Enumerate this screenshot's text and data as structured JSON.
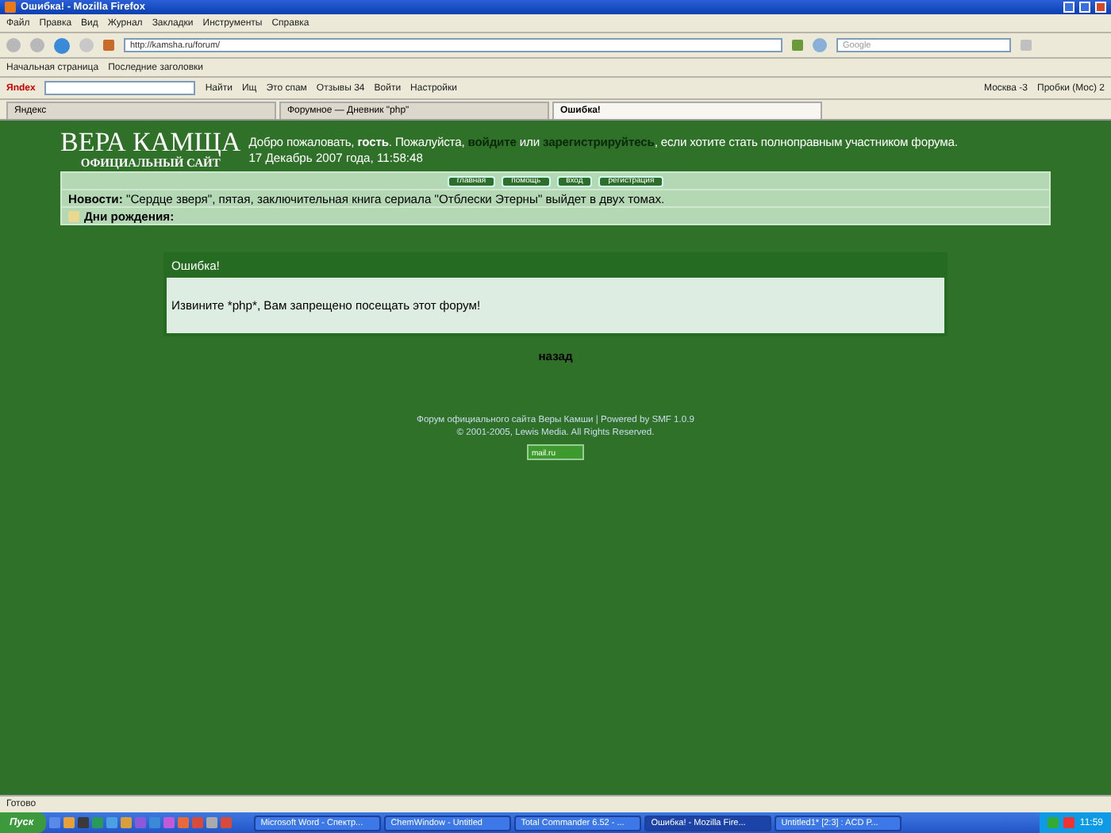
{
  "window": {
    "title": "Ошибка! - Mozilla Firefox"
  },
  "menu": [
    "Файл",
    "Правка",
    "Вид",
    "Журнал",
    "Закладки",
    "Инструменты",
    "Справка"
  ],
  "address": {
    "value": "http://kamsha.ru/forum/"
  },
  "search": {
    "placeholder": "Google"
  },
  "bookmarks": [
    "Начальная страница",
    "Последние заголовки"
  ],
  "yandex_bar": {
    "logo": "Яndex",
    "find_button": "Найти",
    "items": [
      "Ищ",
      "Это спам",
      "Отзывы 34",
      "Войти",
      "Настройки"
    ],
    "weather": "Москва -3",
    "traffic": "Пробки (Мос) 2"
  },
  "tabs": [
    {
      "label": "Яндекс",
      "selected": false
    },
    {
      "label": "Форумное — Дневник \"php\"",
      "selected": false
    },
    {
      "label": "Ошибка!",
      "selected": true
    }
  ],
  "page": {
    "logo_title": "ВЕРА КАМЩА",
    "logo_subtitle": "ОФИЦИАЛЬНЫЙ САЙТ",
    "welcome": [
      {
        "kind": "text",
        "text": "Добро пожаловать, "
      },
      {
        "kind": "bold",
        "text": "гость"
      },
      {
        "kind": "text",
        "text": ". Пожалуйста, "
      },
      {
        "kind": "link",
        "text": "войдите"
      },
      {
        "kind": "text",
        "text": " или "
      },
      {
        "kind": "link",
        "text": "зарегистрируйтесь"
      },
      {
        "kind": "text",
        "text": ", если хотите стать полноправным участником форума."
      }
    ],
    "date": "17 Декабрь 2007 года, 11:58:48",
    "nav_buttons": [
      "главная",
      "помощь",
      "вход",
      "регистрация"
    ],
    "news": {
      "label": "Новости:",
      "text": "\"Сердце зверя\", пятая, заключительная книга сериала \"Отблески Этерны\" выйдет в двух томах."
    },
    "birthdays": {
      "label": "Дни рождения:"
    },
    "error": {
      "title": "Ошибка!",
      "message": "Извините *php*, Вам запрещено посещать этот форум!"
    },
    "back_link": "назад",
    "footer": [
      "Форум официального сайта Веры Камши | Powered by SMF 1.0.9",
      "© 2001-2005, Lewis Media. All Rights Reserved."
    ],
    "counter": "mail.ru"
  },
  "status_bar": "Готово",
  "taskbar": {
    "start": "Пуск",
    "tasks": [
      {
        "label": "Microsoft Word - Спектр...",
        "selected": false
      },
      {
        "label": "ChemWindow - Untitled",
        "selected": false
      },
      {
        "label": "Total Commander 6.52 - ...",
        "selected": false
      },
      {
        "label": "Ошибка! - Mozilla Fire...",
        "selected": true
      },
      {
        "label": "Untitled1* [2:3] : ACD P...",
        "selected": false
      }
    ],
    "clock": "11:59"
  }
}
